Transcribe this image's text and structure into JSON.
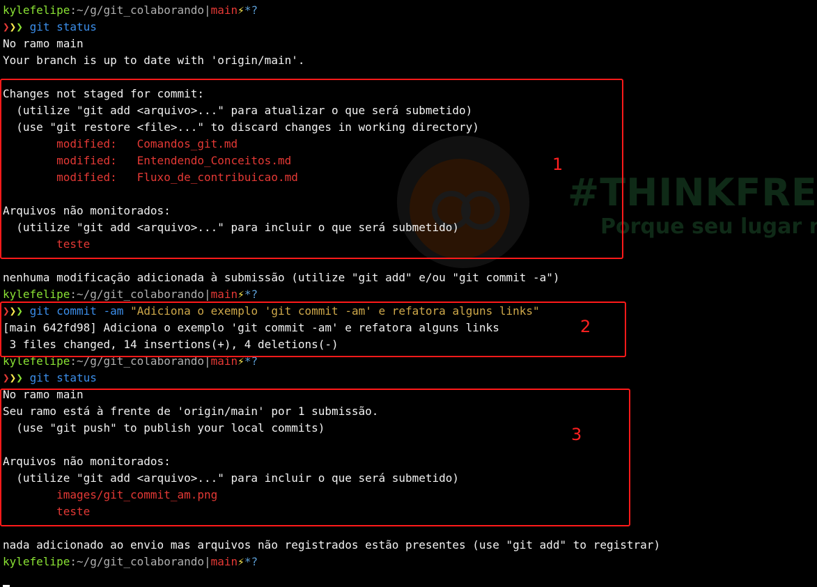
{
  "watermark": {
    "title": "#THINKFRE",
    "subtitle": "Porque seu lugar n"
  },
  "prompt": {
    "user": "kylefelipe",
    "sep": ":",
    "path": "~/g/git_colaborando",
    "pipe": "|",
    "branch": "main",
    "bolt": "⚡",
    "status": "*?"
  },
  "chevrons": "❯❯❯",
  "blocks": {
    "b1": {
      "cmd": "git status",
      "l1": "No ramo main",
      "l2": "Your branch is up to date with 'origin/main'.",
      "l3": "Changes not staged for commit:",
      "l4": "  (utilize \"git add <arquivo>...\" para atualizar o que será submetido)",
      "l5": "  (use \"git restore <file>...\" to discard changes in working directory)",
      "m1": "        modified:   Comandos_git.md",
      "m2": "        modified:   Entendendo_Conceitos.md",
      "m3": "        modified:   Fluxo_de_contribuicao.md",
      "l6": "Arquivos não monitorados:",
      "l7": "  (utilize \"git add <arquivo>...\" para incluir o que será submetido)",
      "u1": "        teste",
      "l8": "nenhuma modificação adicionada à submissão (utilize \"git add\" e/ou \"git commit -a\")"
    },
    "b2": {
      "cmd_git": "git",
      "cmd_rest": " commit -am ",
      "cmd_msg": "\"Adiciona o exemplo 'git commit -am' e refatora alguns links\"",
      "l1": "[main 642fd98] Adiciona o exemplo 'git commit -am' e refatora alguns links",
      "l2": " 3 files changed, 14 insertions(+), 4 deletions(-)"
    },
    "b3": {
      "cmd": "git status",
      "l1": "No ramo main",
      "l2": "Seu ramo está à frente de 'origin/main' por 1 submissão.",
      "l3": "  (use \"git push\" to publish your local commits)",
      "l4": "Arquivos não monitorados:",
      "l5": "  (utilize \"git add <arquivo>...\" para incluir o que será submetido)",
      "u1": "        images/git_commit_am.png",
      "u2": "        teste",
      "l6": "nada adicionado ao envio mas arquivos não registrados estão presentes (use \"git add\" to registrar)"
    }
  },
  "annotations": {
    "a1": "1",
    "a2": "2",
    "a3": "3"
  },
  "colors": {
    "highlight": "#ff1a1a",
    "background": "#000000"
  }
}
